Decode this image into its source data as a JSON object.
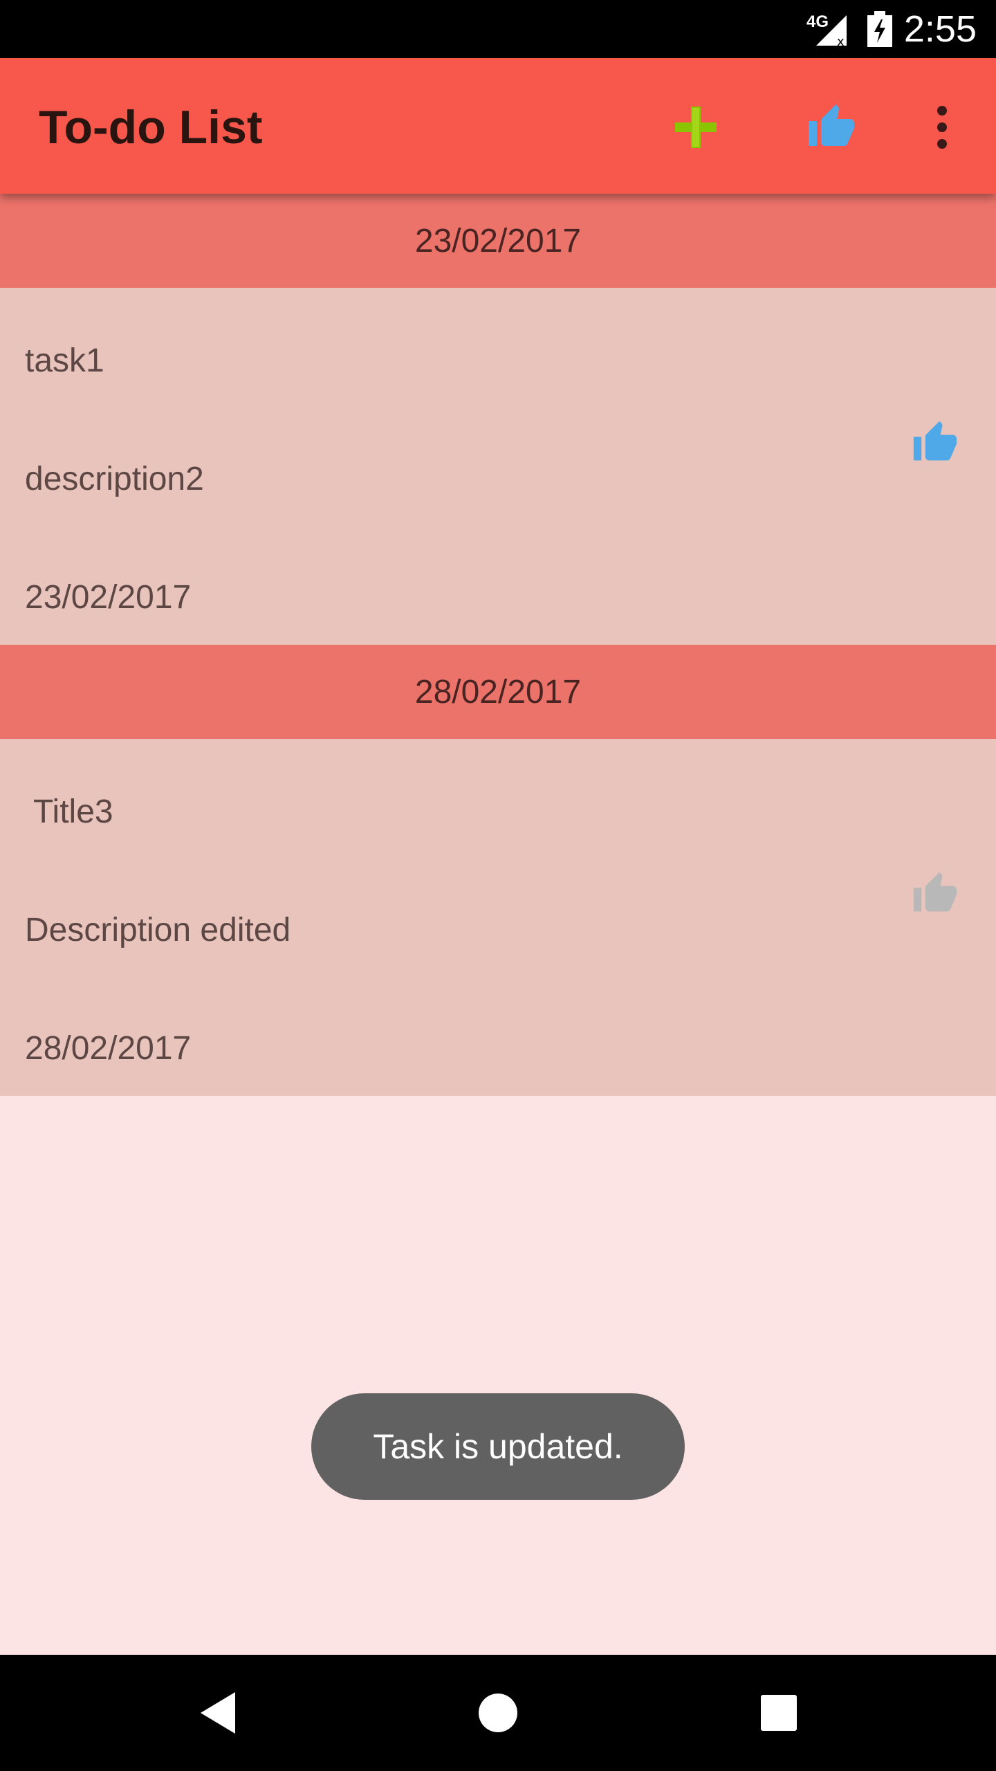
{
  "status_bar": {
    "time": "2:55",
    "network": "4G",
    "icons": [
      "signal-icon",
      "battery-charging-icon"
    ]
  },
  "app_bar": {
    "title": "To-do List",
    "actions": [
      {
        "name": "add-icon",
        "color": "#8BC400"
      },
      {
        "name": "thumbs-up-icon",
        "color": "#4FA8E8"
      },
      {
        "name": "more-vert-icon",
        "color": "#3a1a18"
      }
    ]
  },
  "colors": {
    "app_bar": "#F7584B",
    "date_header": "#EC736A",
    "task_card": "#E8C4BC",
    "background": "#FCE4E4",
    "like_active": "#4FA8E8",
    "like_inactive": "#B8B8B8",
    "toast": "#616161"
  },
  "groups": [
    {
      "date_header": "23/02/2017",
      "task": {
        "title": "task1",
        "description": "description2",
        "date": "23/02/2017",
        "liked": true
      }
    },
    {
      "date_header": "28/02/2017",
      "task": {
        "title": "Title3",
        "description": "Description edited",
        "date": "28/02/2017",
        "liked": false
      }
    }
  ],
  "toast": {
    "message": "Task is updated."
  },
  "nav_bar": {
    "buttons": [
      "back-icon",
      "home-icon",
      "recents-icon"
    ]
  }
}
